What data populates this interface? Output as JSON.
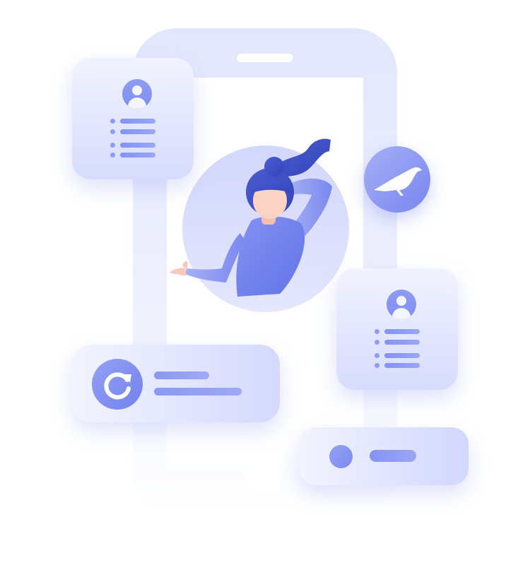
{
  "illustration": {
    "colors": {
      "phone_frame": "#e3e7fd",
      "card_top": "#f1f3fe",
      "card_bottom": "#d7dcfd",
      "accent": "#7f8ef2",
      "accent_dark": "#3f51c6",
      "skin": "#fbd3c4"
    },
    "icons": {
      "left_profile": "user-avatar-icon",
      "right_profile": "user-avatar-icon",
      "refresh": "refresh-icon",
      "bird": "bird-icon"
    }
  }
}
